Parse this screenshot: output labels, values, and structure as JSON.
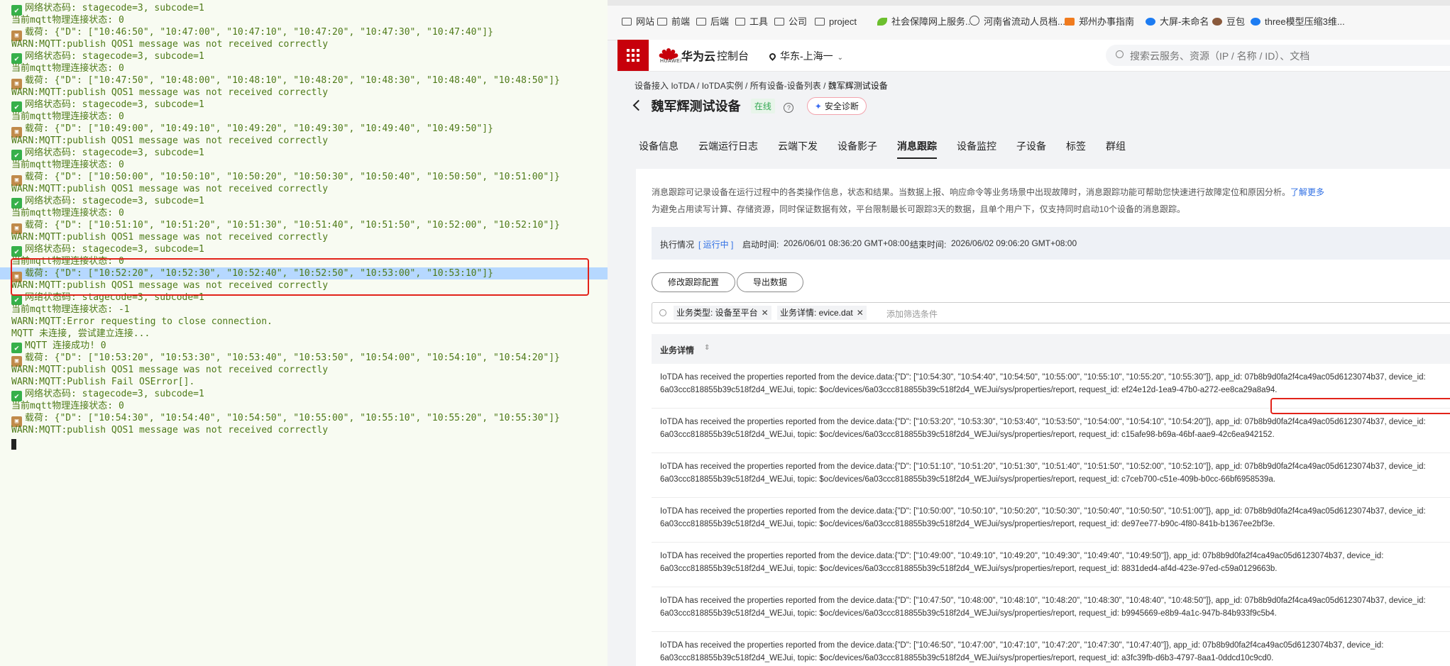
{
  "terminal": {
    "lines": [
      {
        "icon": "check",
        "text": "网络状态码: stagecode=3, subcode=1"
      },
      {
        "icon": "",
        "text": "当前mqtt物理连接状态: 0"
      },
      {
        "icon": "box",
        "text": "载荷: {\"D\": [\"10:46:50\", \"10:47:00\", \"10:47:10\", \"10:47:20\", \"10:47:30\", \"10:47:40\"]}"
      },
      {
        "icon": "",
        "text": "WARN:MQTT:publish QOS1 message was not received correctly"
      },
      {
        "icon": "check",
        "text": "网络状态码: stagecode=3, subcode=1"
      },
      {
        "icon": "",
        "text": "当前mqtt物理连接状态: 0"
      },
      {
        "icon": "box",
        "text": "载荷: {\"D\": [\"10:47:50\", \"10:48:00\", \"10:48:10\", \"10:48:20\", \"10:48:30\", \"10:48:40\", \"10:48:50\"]}"
      },
      {
        "icon": "",
        "text": "WARN:MQTT:publish QOS1 message was not received correctly"
      },
      {
        "icon": "check",
        "text": "网络状态码: stagecode=3, subcode=1"
      },
      {
        "icon": "",
        "text": "当前mqtt物理连接状态: 0"
      },
      {
        "icon": "box",
        "text": "载荷: {\"D\": [\"10:49:00\", \"10:49:10\", \"10:49:20\", \"10:49:30\", \"10:49:40\", \"10:49:50\"]}"
      },
      {
        "icon": "",
        "text": "WARN:MQTT:publish QOS1 message was not received correctly"
      },
      {
        "icon": "check",
        "text": "网络状态码: stagecode=3, subcode=1"
      },
      {
        "icon": "",
        "text": "当前mqtt物理连接状态: 0"
      },
      {
        "icon": "box",
        "text": "载荷: {\"D\": [\"10:50:00\", \"10:50:10\", \"10:50:20\", \"10:50:30\", \"10:50:40\", \"10:50:50\", \"10:51:00\"]}"
      },
      {
        "icon": "",
        "text": "WARN:MQTT:publish QOS1 message was not received correctly"
      },
      {
        "icon": "check",
        "text": "网络状态码: stagecode=3, subcode=1"
      },
      {
        "icon": "",
        "text": "当前mqtt物理连接状态: 0"
      },
      {
        "icon": "box",
        "text": "载荷: {\"D\": [\"10:51:10\", \"10:51:20\", \"10:51:30\", \"10:51:40\", \"10:51:50\", \"10:52:00\", \"10:52:10\"]}"
      },
      {
        "icon": "",
        "text": "WARN:MQTT:publish QOS1 message was not received correctly"
      },
      {
        "icon": "check",
        "text": "网络状态码: stagecode=3, subcode=1"
      },
      {
        "icon": "",
        "text": "当前mqtt物理连接状态: 0"
      },
      {
        "icon": "box",
        "text": "载荷: {\"D\": [\"10:52:20\", \"10:52:30\", \"10:52:40\", \"10:52:50\", \"10:53:00\", \"10:53:10\"]}",
        "highlight": true
      },
      {
        "icon": "",
        "text": "WARN:MQTT:publish QOS1 message was not received correctly"
      },
      {
        "icon": "check",
        "text": "网络状态码: stagecode=3, subcode=1"
      },
      {
        "icon": "",
        "text": "当前mqtt物理连接状态: -1"
      },
      {
        "icon": "",
        "text": "WARN:MQTT:Error requesting to close connection."
      },
      {
        "icon": "",
        "text": "MQTT 未连接, 尝试建立连接..."
      },
      {
        "icon": "check",
        "text": "MQTT 连接成功! 0"
      },
      {
        "icon": "box",
        "text": "载荷: {\"D\": [\"10:53:20\", \"10:53:30\", \"10:53:40\", \"10:53:50\", \"10:54:00\", \"10:54:10\", \"10:54:20\"]}"
      },
      {
        "icon": "",
        "text": "WARN:MQTT:publish QOS1 message was not received correctly"
      },
      {
        "icon": "",
        "text": "WARN:MQTT:Publish Fail OSError[]."
      },
      {
        "icon": "check",
        "text": "网络状态码: stagecode=3, subcode=1"
      },
      {
        "icon": "",
        "text": "当前mqtt物理连接状态: 0"
      },
      {
        "icon": "box",
        "text": "载荷: {\"D\": [\"10:54:30\", \"10:54:40\", \"10:54:50\", \"10:55:00\", \"10:55:10\", \"10:55:20\", \"10:55:30\"]}"
      },
      {
        "icon": "",
        "text": "WARN:MQTT:publish QOS1 message was not received correctly"
      }
    ]
  },
  "bookmarks": [
    {
      "label": "网站",
      "icon": "folder"
    },
    {
      "label": "前端",
      "icon": "folder"
    },
    {
      "label": "后端",
      "icon": "folder"
    },
    {
      "label": "工具",
      "icon": "folder"
    },
    {
      "label": "公司",
      "icon": "folder"
    },
    {
      "label": "project",
      "icon": "folder"
    },
    {
      "label": "社会保障网上服务...",
      "icon": "leaf"
    },
    {
      "label": "河南省流动人员档...",
      "icon": "globe"
    },
    {
      "label": "郑州办事指南",
      "icon": "orange"
    },
    {
      "label": "大屏-未命名",
      "icon": "blue"
    },
    {
      "label": "豆包",
      "icon": "brown"
    },
    {
      "label": "three模型压缩3维...",
      "icon": "blue"
    }
  ],
  "header": {
    "brand": "华为云",
    "brand_small": "HUAWEI",
    "console": "控制台",
    "region": "华东-上海一",
    "search_placeholder": "搜索云服务、资源（IP / 名称 / ID）、文档"
  },
  "breadcrumb": {
    "items": [
      "设备接入 IoTDA",
      "IoTDA实例",
      "所有设备-设备列表"
    ],
    "current": "魏军辉测试设备"
  },
  "device": {
    "title": "魏军辉测试设备",
    "status": "在线",
    "help": "?",
    "diag_button": "安全诊断"
  },
  "tabs": [
    "设备信息",
    "云端运行日志",
    "云端下发",
    "设备影子",
    "消息跟踪",
    "设备监控",
    "子设备",
    "标签",
    "群组"
  ],
  "active_tab": "消息跟踪",
  "trace": {
    "desc1": "消息跟踪可记录设备在运行过程中的各类操作信息，状态和结果。当数据上报、响应命令等业务场景中出现故障时，消息跟踪功能可帮助您快速进行故障定位和原因分析。",
    "learn_more": "了解更多",
    "desc2": "为避免占用读写计算、存储资源，同时保证数据有效，平台限制最长可跟踪3天的数据，且单个用户下，仅支持同时启动10个设备的消息跟踪。",
    "exec_label": "执行情况",
    "exec_status": "[ 运行中 ]",
    "start_label": "启动时间:",
    "start_time": "2026/06/01 08:36:20 GMT+08:00",
    "end_label": "结束时间:",
    "end_time": "2026/06/02 09:06:20 GMT+08:00",
    "btn_modify": "修改跟踪配置",
    "btn_export": "导出数据",
    "filter_chip1": "业务类型: 设备至平台",
    "filter_chip2": "业务详情: evice.dat",
    "filter_placeholder": "添加筛选条件",
    "column_header": "业务详情"
  },
  "rows": [
    {
      "t1": "IoTDA has received the properties reported from the device.data:{\"D\": [\"10:54:30\", \"10:54:40\", \"10:54:50\", \"10:55:00\", \"10:55:10\", \"10:55:20\", \"10:55:30\"]}, app_id: 07b8b9d0fa2f4ca49ac05d6123074b37, device_id:",
      "t2": "6a03ccc818855b39c518f2d4_WEJui, topic: $oc/devices/6a03ccc818855b39c518f2d4_WEJui/sys/properties/report, request_id: ef24e12d-1ea9-47b0-a272-ee8ca29a8a94."
    },
    {
      "t1": "IoTDA has received the properties reported from the device.data:{\"D\": [\"10:53:20\", \"10:53:30\", \"10:53:40\", \"10:53:50\", \"10:54:00\", \"10:54:10\", \"10:54:20\"]}, app_id: 07b8b9d0fa2f4ca49ac05d6123074b37, device_id:",
      "t2": "6a03ccc818855b39c518f2d4_WEJui, topic: $oc/devices/6a03ccc818855b39c518f2d4_WEJui/sys/properties/report, request_id: c15afe98-b69a-46bf-aae9-42c6ea942152."
    },
    {
      "t1": "IoTDA has received the properties reported from the device.data:{\"D\": [\"10:51:10\", \"10:51:20\", \"10:51:30\", \"10:51:40\", \"10:51:50\", \"10:52:00\", \"10:52:10\"]}, app_id: 07b8b9d0fa2f4ca49ac05d6123074b37, device_id:",
      "t2": "6a03ccc818855b39c518f2d4_WEJui, topic: $oc/devices/6a03ccc818855b39c518f2d4_WEJui/sys/properties/report, request_id: c7ceb700-c51e-409b-b0cc-66bf6958539a."
    },
    {
      "t1": "IoTDA has received the properties reported from the device.data:{\"D\": [\"10:50:00\", \"10:50:10\", \"10:50:20\", \"10:50:30\", \"10:50:40\", \"10:50:50\", \"10:51:00\"]}, app_id: 07b8b9d0fa2f4ca49ac05d6123074b37, device_id:",
      "t2": "6a03ccc818855b39c518f2d4_WEJui, topic: $oc/devices/6a03ccc818855b39c518f2d4_WEJui/sys/properties/report, request_id: de97ee77-b90c-4f80-841b-b1367ee2bf3e."
    },
    {
      "t1": "IoTDA has received the properties reported from the device.data:{\"D\": [\"10:49:00\", \"10:49:10\", \"10:49:20\", \"10:49:30\", \"10:49:40\", \"10:49:50\"]}, app_id: 07b8b9d0fa2f4ca49ac05d6123074b37, device_id:",
      "t2": "6a03ccc818855b39c518f2d4_WEJui, topic: $oc/devices/6a03ccc818855b39c518f2d4_WEJui/sys/properties/report, request_id: 8831ded4-af4d-423e-97ed-c59a0129663b."
    },
    {
      "t1": "IoTDA has received the properties reported from the device.data:{\"D\": [\"10:47:50\", \"10:48:00\", \"10:48:10\", \"10:48:20\", \"10:48:30\", \"10:48:40\", \"10:48:50\"]}, app_id: 07b8b9d0fa2f4ca49ac05d6123074b37, device_id:",
      "t2": "6a03ccc818855b39c518f2d4_WEJui, topic: $oc/devices/6a03ccc818855b39c518f2d4_WEJui/sys/properties/report, request_id: b9945669-e8b9-4a1c-947b-84b933f9c5b4."
    },
    {
      "t1": "IoTDA has received the properties reported from the device.data:{\"D\": [\"10:46:50\", \"10:47:00\", \"10:47:10\", \"10:47:20\", \"10:47:30\", \"10:47:40\"]}, app_id: 07b8b9d0fa2f4ca49ac05d6123074b37, device_id:",
      "t2": "6a03ccc818855b39c518f2d4_WEJui, topic: $oc/devices/6a03ccc818855b39c518f2d4_WEJui/sys/properties/report, request_id: a3fc39fb-d6b3-4797-8aa1-0ddcd10c9cd0."
    }
  ]
}
